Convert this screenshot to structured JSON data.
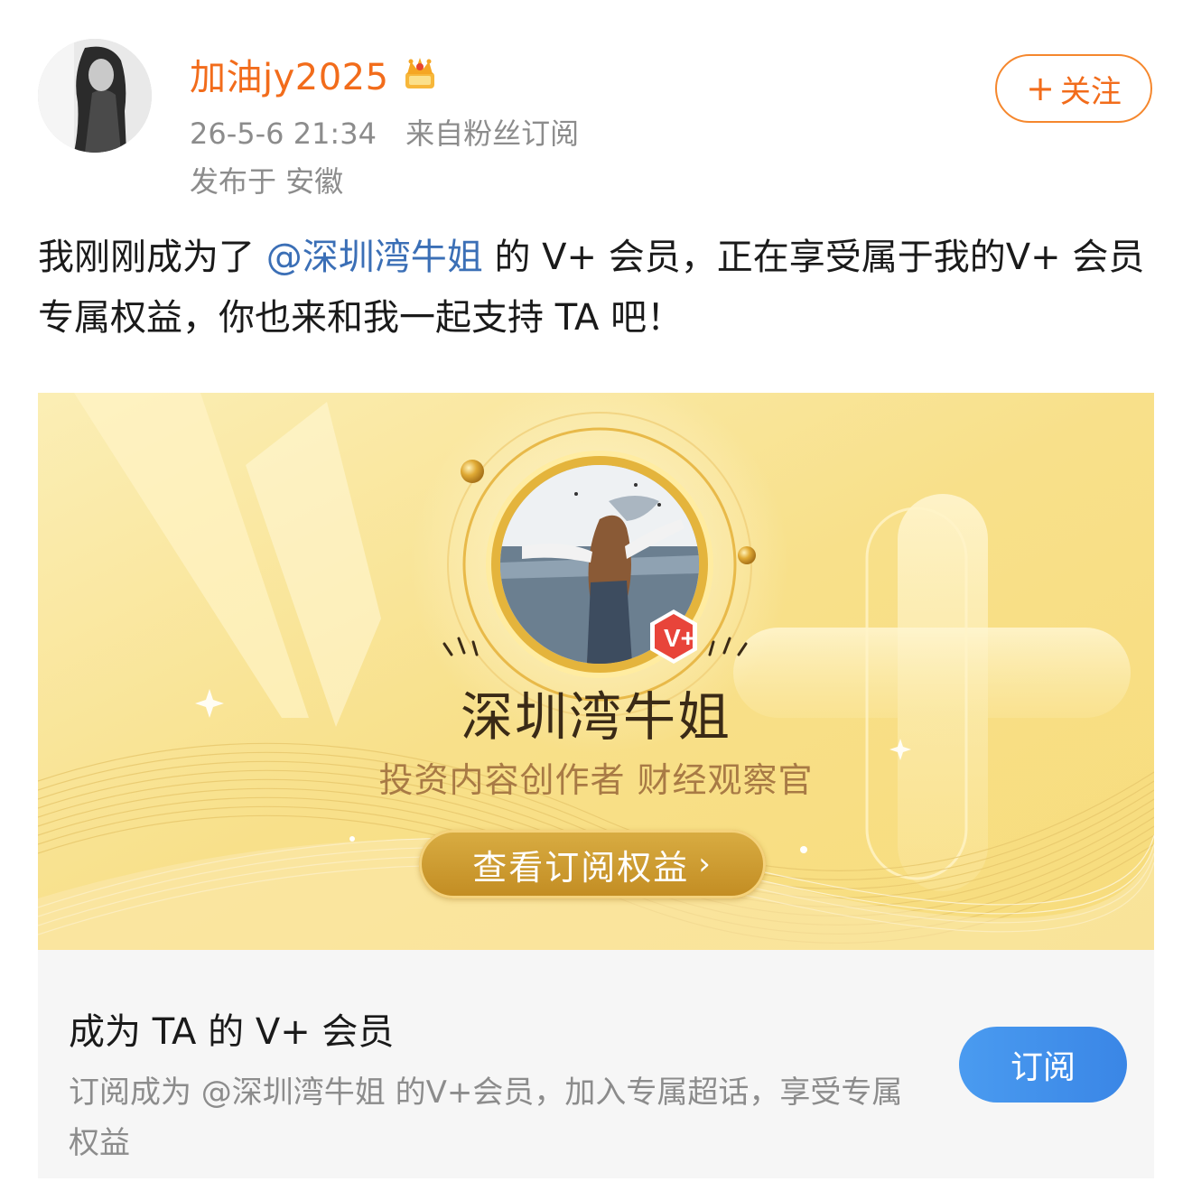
{
  "post": {
    "author": {
      "name": "加油jy2025",
      "badge_icon": "crown-icon"
    },
    "time": "26-5-6 21:34",
    "source": "来自粉丝订阅",
    "location": "发布于 安徽",
    "follow": {
      "icon": "+",
      "label": "关注"
    },
    "text": {
      "part1": "我刚刚成为了",
      "mention": "@深圳湾牛姐",
      "part2": "的 V+ 会员，正在享受属于我的V+ 会员专属权益，你也来和我一起支持 TA 吧！"
    }
  },
  "card": {
    "creator_name": "深圳湾牛姐",
    "creator_desc": "投资内容创作者 财经观察官",
    "badge_label": "V+",
    "view_button": {
      "label": "查看订阅权益",
      "icon": "›"
    },
    "footer": {
      "title": "成为 TA 的 V+ 会员",
      "desc": "订阅成为 @深圳湾牛姐 的V+会员，加入专属超话，享受专属权益",
      "subscribe_label": "订阅"
    }
  },
  "colors": {
    "username": "#f26c1b",
    "mention": "#3b6fb6",
    "subscribe": "#3a86e6",
    "gold": "#c28c22"
  }
}
